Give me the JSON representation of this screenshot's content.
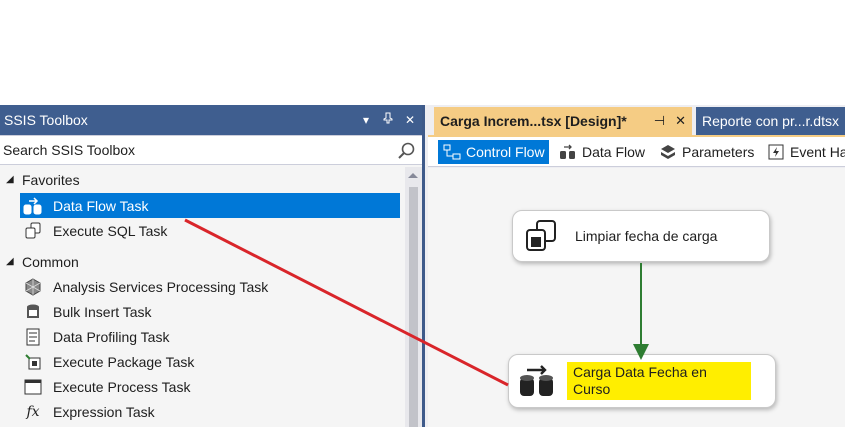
{
  "toolbox": {
    "title": "SSIS Toolbox",
    "search_placeholder": "Search SSIS Toolbox",
    "groups": [
      {
        "label": "Favorites",
        "items": [
          {
            "label": "Data Flow Task",
            "icon": "data-flow-task-icon",
            "selected": true
          },
          {
            "label": "Execute SQL Task",
            "icon": "execute-sql-task-icon",
            "selected": false
          }
        ]
      },
      {
        "label": "Common",
        "items": [
          {
            "label": "Analysis Services Processing Task",
            "icon": "analysis-services-icon"
          },
          {
            "label": "Bulk Insert Task",
            "icon": "bulk-insert-icon"
          },
          {
            "label": "Data Profiling Task",
            "icon": "data-profiling-icon"
          },
          {
            "label": "Execute Package Task",
            "icon": "execute-package-icon"
          },
          {
            "label": "Execute Process Task",
            "icon": "execute-process-icon"
          },
          {
            "label": "Expression Task",
            "icon": "expression-icon"
          }
        ]
      }
    ]
  },
  "designer": {
    "active_tab": "Carga Increm...tsx [Design]*",
    "inactive_tab": "Reporte con pr...r.dtsx",
    "design_tabs": [
      {
        "label": "Control Flow",
        "icon": "control-flow-icon",
        "active": true
      },
      {
        "label": "Data Flow",
        "icon": "data-flow-icon",
        "active": false
      },
      {
        "label": "Parameters",
        "icon": "parameters-icon",
        "active": false
      },
      {
        "label": "Event Ha",
        "icon": "event-handlers-icon",
        "active": false
      }
    ],
    "tasks": [
      {
        "label": "Limpiar fecha de carga",
        "icon": "execute-sql-task-icon"
      },
      {
        "label": "Carga Data Fecha en Curso",
        "icon": "data-flow-task-icon",
        "highlighted": true
      }
    ]
  },
  "colors": {
    "title_bar": "#3f5e8f",
    "selection": "#0078d7",
    "active_doc_tab": "#f5cc84",
    "precedence_arrow": "#2e7d32",
    "annotation_arrow": "#d9252a",
    "highlight": "#ffee00"
  }
}
